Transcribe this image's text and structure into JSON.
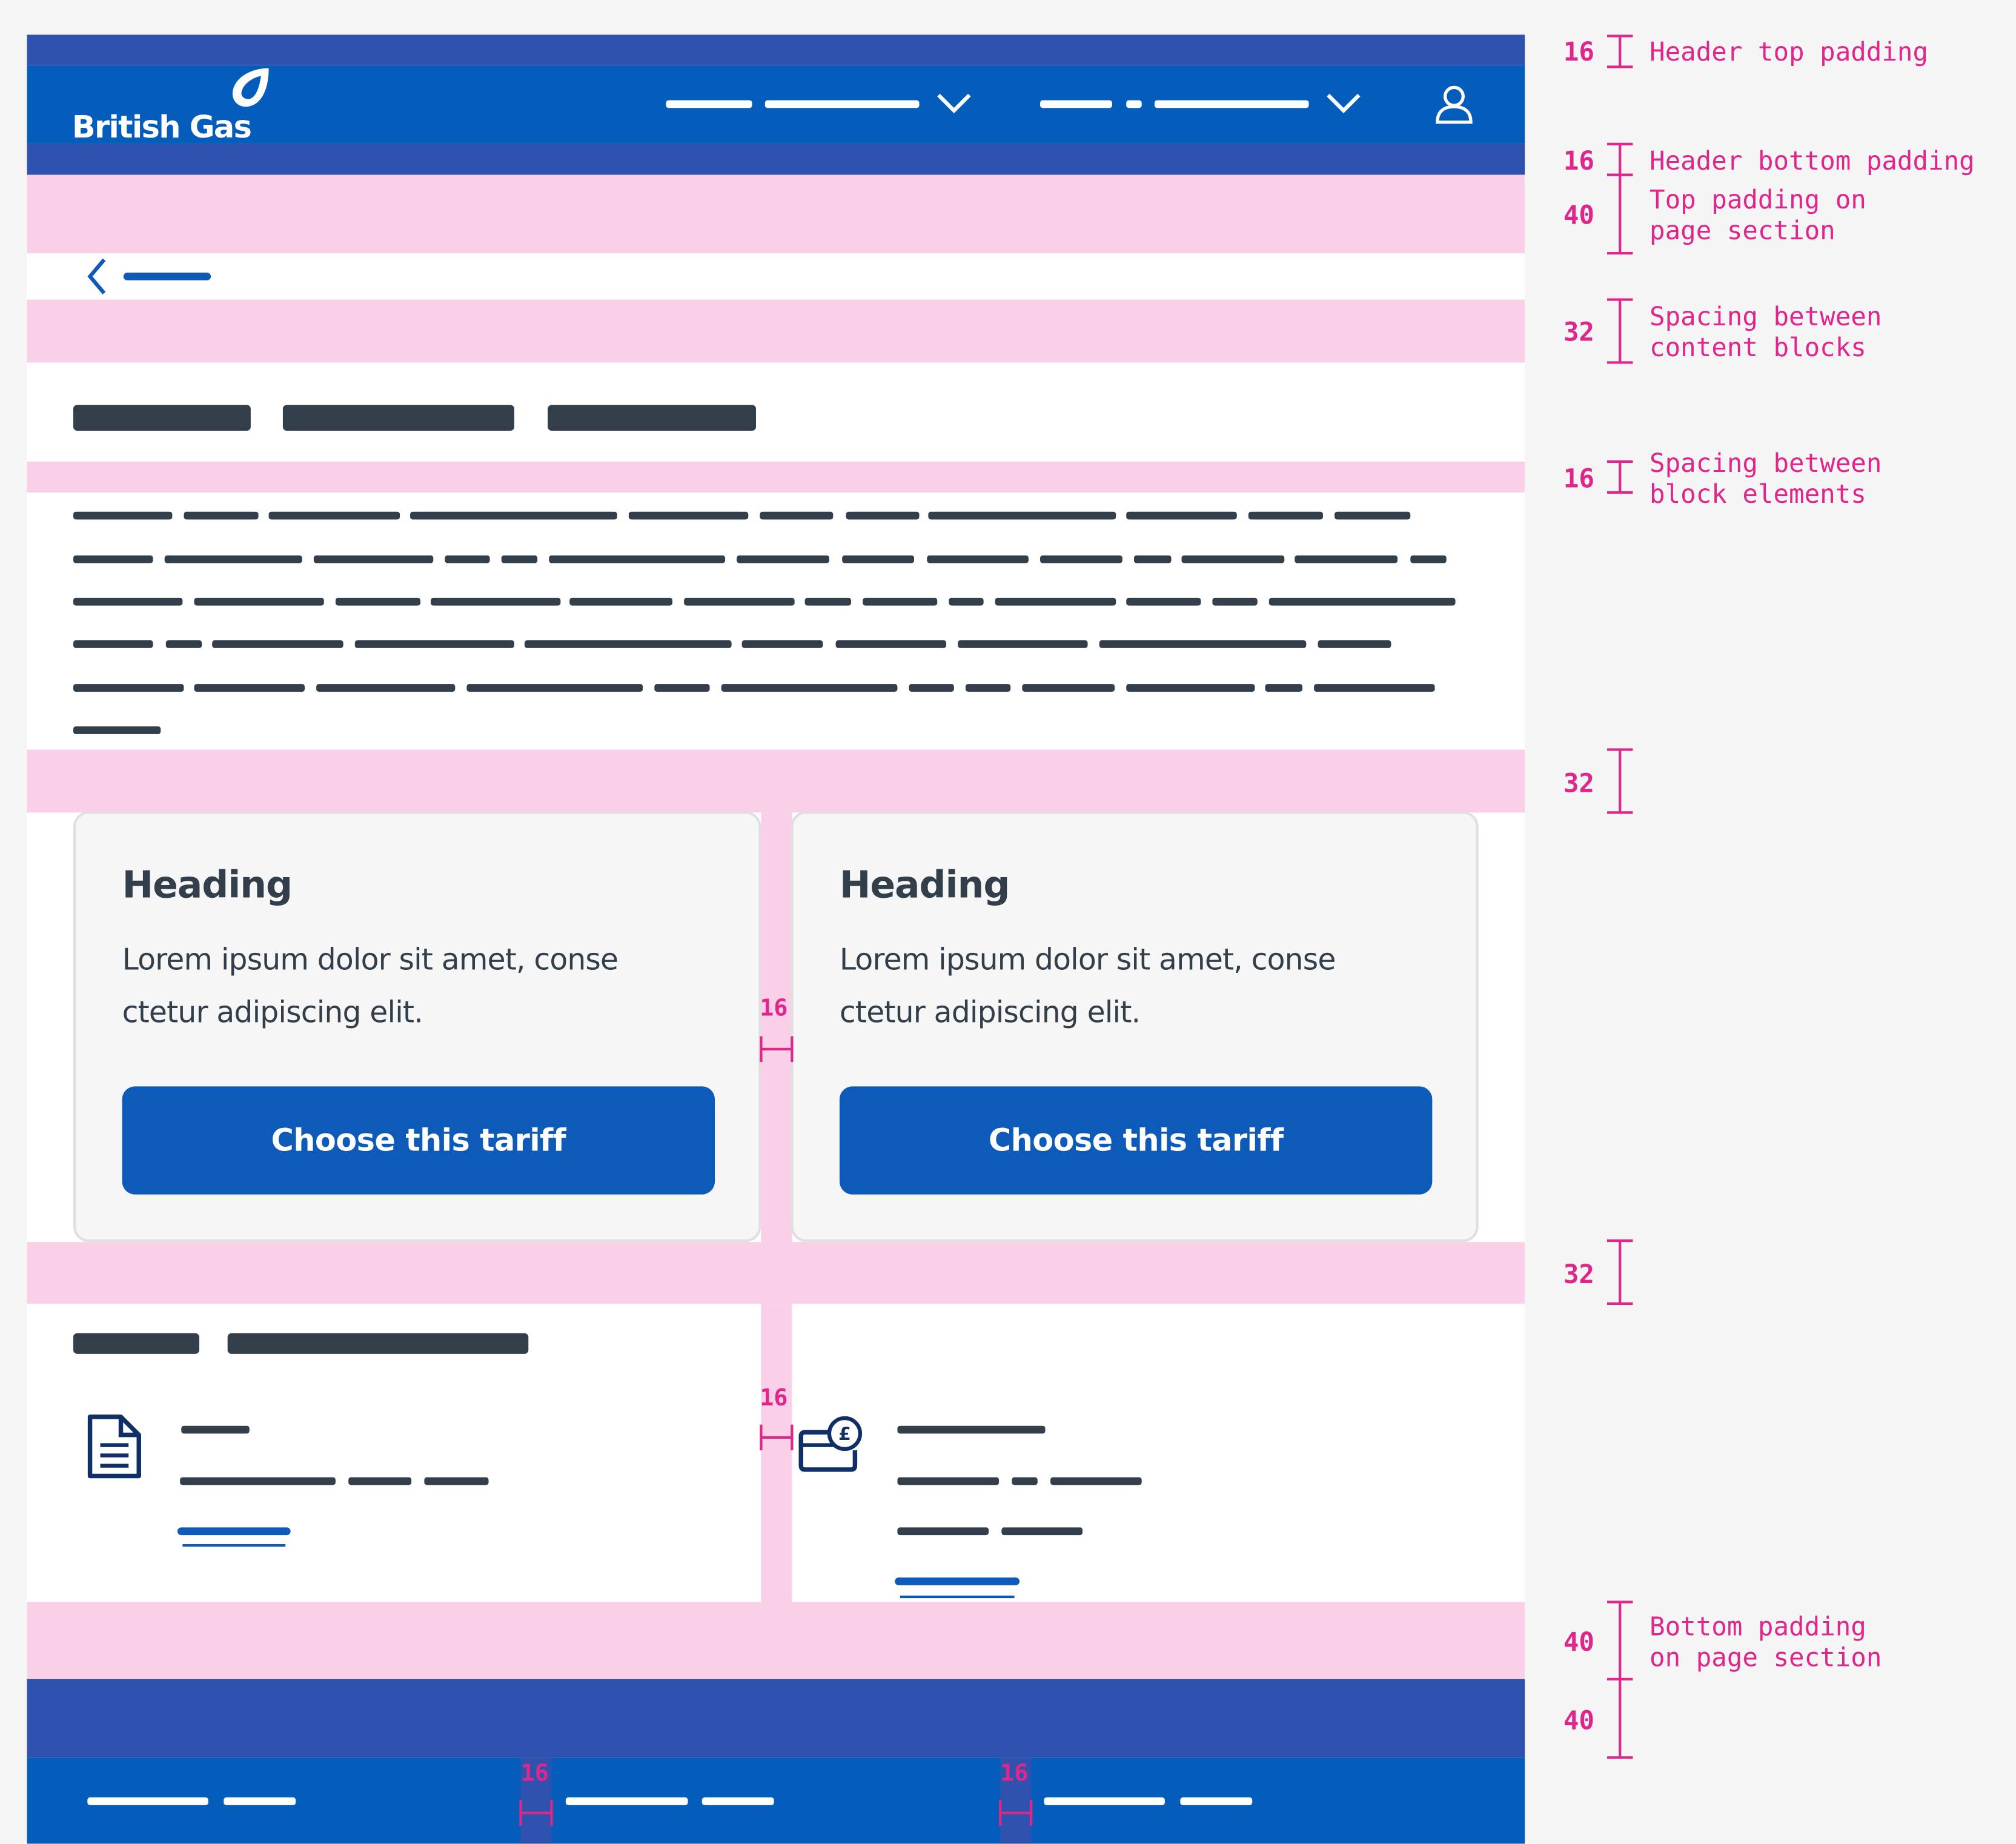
{
  "brand": {
    "logo_text": "British Gas"
  },
  "header": {
    "nav_1_icon": "chevron-down-icon",
    "nav_2_icon": "chevron-down-icon",
    "account_icon": "user-icon"
  },
  "back_link": {
    "icon": "chevron-left-icon"
  },
  "cards": [
    {
      "heading": "Heading",
      "body": "Lorem ipsum dolor sit amet, conse ctetur adipiscing elit.",
      "button": "Choose this tariff"
    },
    {
      "heading": "Heading",
      "body": "Lorem ipsum dolor sit amet, conse ctetur adipiscing elit.",
      "button": "Choose this tariff"
    }
  ],
  "info_blocks": [
    {
      "icon": "document-icon"
    },
    {
      "icon": "wallet-pound-icon"
    }
  ],
  "annotations": {
    "header_top": {
      "value": "16",
      "label": "Header top padding"
    },
    "header_bottom": {
      "value": "16",
      "label": "Header bottom padding"
    },
    "section_top": {
      "value": "40",
      "label": "Top padding on\npage section"
    },
    "content_blocks": {
      "value": "32",
      "label": "Spacing between\ncontent blocks"
    },
    "block_elements": {
      "value": "16",
      "label": "Spacing between\nblock elements"
    },
    "gap_32_a": {
      "value": "32"
    },
    "gap_32_b": {
      "value": "32"
    },
    "section_bottom": {
      "value": "40",
      "label": "Bottom padding\non page section"
    },
    "footer_top": {
      "value": "40"
    },
    "card_gutter": {
      "value": "16"
    },
    "info_gutter": {
      "value": "16"
    },
    "footer_gutter_1": {
      "value": "16"
    },
    "footer_gutter_2": {
      "value": "16"
    }
  },
  "colors": {
    "brand_blue": "#0d5ab8",
    "header_padding": "#2e52ad",
    "annotation_pink": "#e0268a",
    "spacing_fill": "#f9d0e8",
    "skeleton_text": "#323e4a"
  }
}
